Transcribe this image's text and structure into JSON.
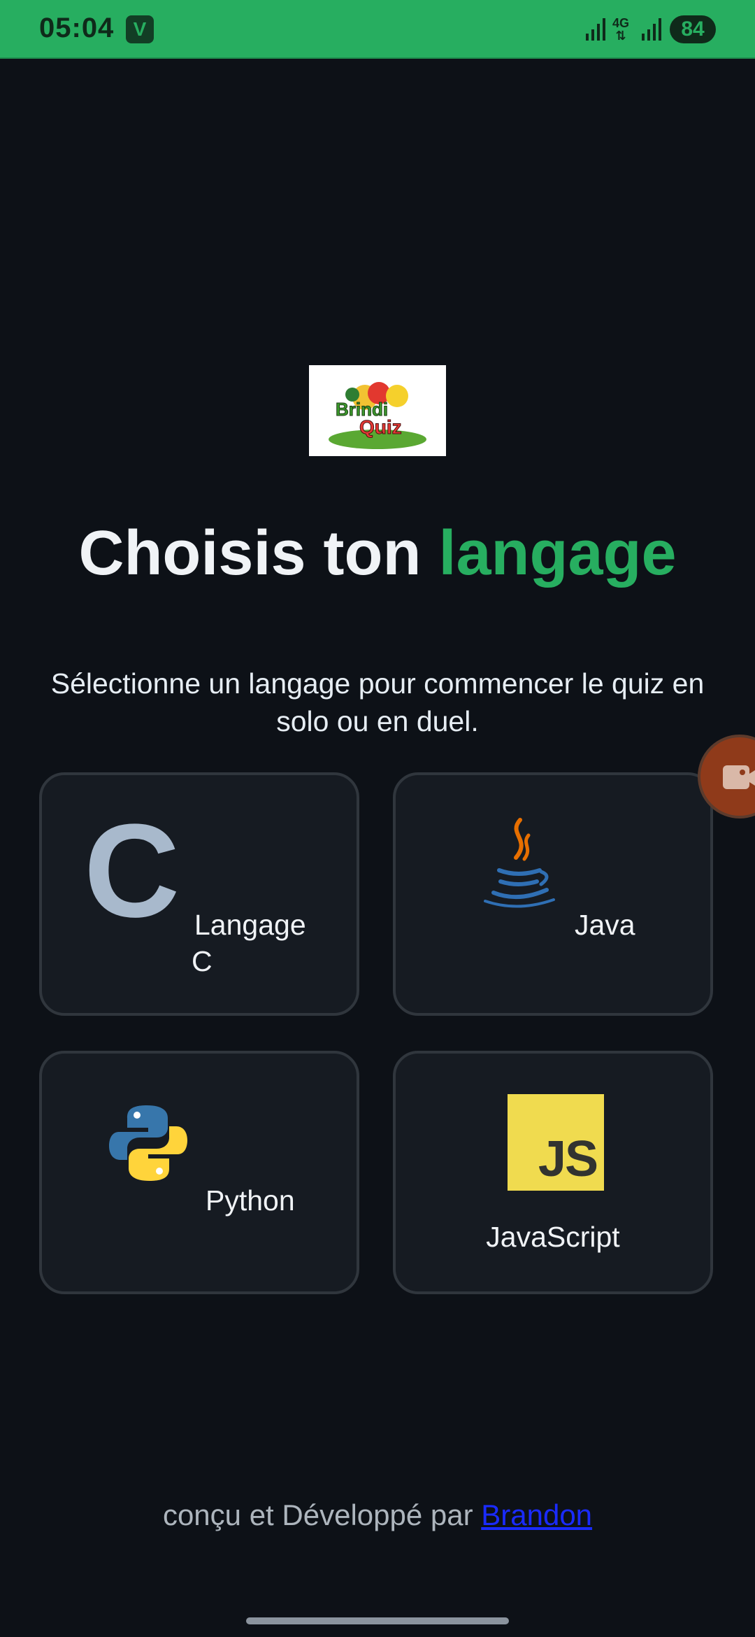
{
  "status_bar": {
    "time": "05:04",
    "app_icon_letter": "V",
    "network": "4G",
    "battery": "84"
  },
  "logo": {
    "alt": "Brindi Quiz logo",
    "text_top": "Brindi",
    "text_bottom": "Quiz"
  },
  "title": {
    "main": "Choisis ton ",
    "accent": "langage",
    "accent_color": "#27ae60"
  },
  "subtitle": "Sélectionne un langage pour commencer le quiz en solo ou en duel.",
  "languages": [
    {
      "label_line1": "Langage",
      "label_line2": "C",
      "icon": "c-language-icon"
    },
    {
      "label": "Java",
      "icon": "java-icon"
    },
    {
      "label": "Python",
      "icon": "python-icon"
    },
    {
      "label": "JavaScript",
      "icon": "javascript-icon",
      "icon_text": "JS"
    }
  ],
  "footer": {
    "text": "conçu et Développé par ",
    "link": "Brandon"
  },
  "colors": {
    "background": "#0d1117",
    "card": "#161b22",
    "status_bar": "#27ae60"
  }
}
